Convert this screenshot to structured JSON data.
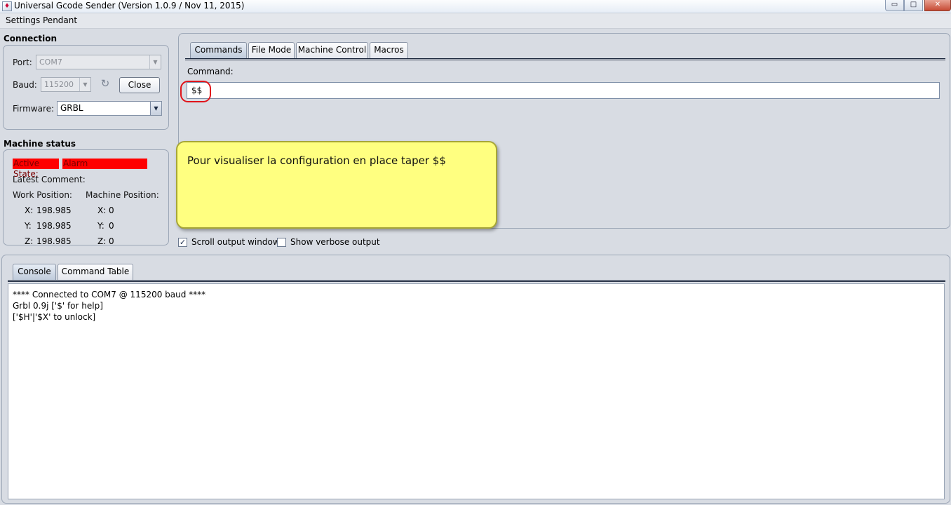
{
  "window": {
    "title": "Universal Gcode Sender (Version 1.0.9 / Nov 11, 2015)",
    "minimize_glyph": "▭",
    "maximize_glyph": "□",
    "close_glyph": "✕"
  },
  "menu": {
    "items": [
      "Settings",
      "Pendant"
    ]
  },
  "connection": {
    "title": "Connection",
    "port_label": "Port:",
    "port_value": "COM7",
    "baud_label": "Baud:",
    "baud_value": "115200",
    "refresh_glyph": "↻",
    "close_button": "Close",
    "firmware_label": "Firmware:",
    "firmware_value": "GRBL"
  },
  "machine_status": {
    "title": "Machine status",
    "active_state_label": "Active State:",
    "active_state_value": "Alarm",
    "latest_comment_label": "Latest Comment:",
    "work_position_label": "Work Position:",
    "machine_position_label": "Machine Position:",
    "work": {
      "x_label": "X:",
      "x": "198.985",
      "y_label": "Y:",
      "y": "198.985",
      "z_label": "Z:",
      "z": "198.985"
    },
    "machine": {
      "x_label": "X:",
      "x": "0",
      "y_label": "Y:",
      "y": "0",
      "z_label": "Z:",
      "z": "0"
    }
  },
  "top_tabs": [
    "Commands",
    "File Mode",
    "Machine Control",
    "Macros"
  ],
  "command": {
    "label": "Command:",
    "value": "$$"
  },
  "callout": {
    "text": "Pour visualiser la configuration en place taper $$"
  },
  "options": {
    "scroll_output": {
      "label": "Scroll output window",
      "checked": true,
      "check_glyph": "✓"
    },
    "verbose_output": {
      "label": "Show verbose output",
      "checked": false
    }
  },
  "bottom_tabs": [
    "Console",
    "Command Table"
  ],
  "console": {
    "lines": [
      "**** Connected to COM7 @ 115200 baud ****",
      "",
      "Grbl 0.9j ['$' for help]",
      "['$H'|'$X' to unlock]"
    ]
  },
  "colors": {
    "alarm": "#ff0000",
    "callout_bg": "#ffff80",
    "highlight_ring": "#e0141b"
  }
}
